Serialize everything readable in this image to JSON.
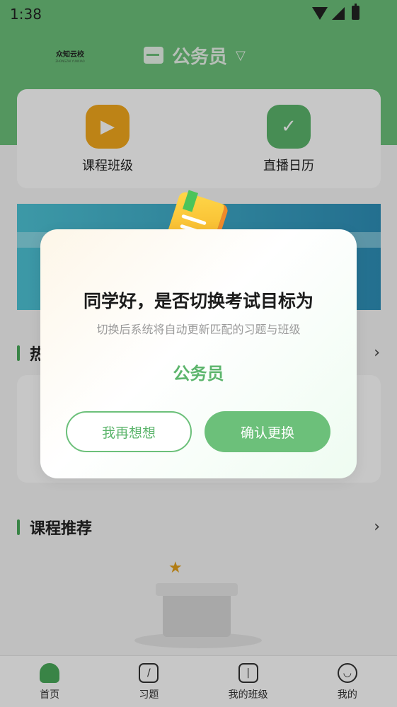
{
  "status_bar": {
    "time": "1:38"
  },
  "header": {
    "logo_text": "众知云校",
    "logo_subtext": "ZHONGZHI YUNXIAO",
    "goal_label": "公务员"
  },
  "quick_links": [
    {
      "label": "课程班级",
      "icon": "video-book-icon",
      "color": "#f2a81d"
    },
    {
      "label": "直播日历",
      "icon": "calendar-check-icon",
      "color": "#5cb56c"
    }
  ],
  "sections": {
    "hot_title": "热",
    "recommend_title": "课程推荐"
  },
  "modal": {
    "title": "同学好，是否切换考试目标为",
    "subtitle": "切换后系统将自动更新匹配的习题与班级",
    "goal": "公务员",
    "cancel_label": "我再想想",
    "confirm_label": "确认更换"
  },
  "bottom_nav": [
    {
      "label": "首页",
      "icon": "home-icon",
      "active": true
    },
    {
      "label": "习题",
      "icon": "pencil-icon",
      "active": false
    },
    {
      "label": "我的班级",
      "icon": "class-icon",
      "active": false
    },
    {
      "label": "我的",
      "icon": "smile-icon",
      "active": false
    }
  ],
  "colors": {
    "brand_green": "#6cc07a",
    "accent_orange": "#f2a81d"
  }
}
